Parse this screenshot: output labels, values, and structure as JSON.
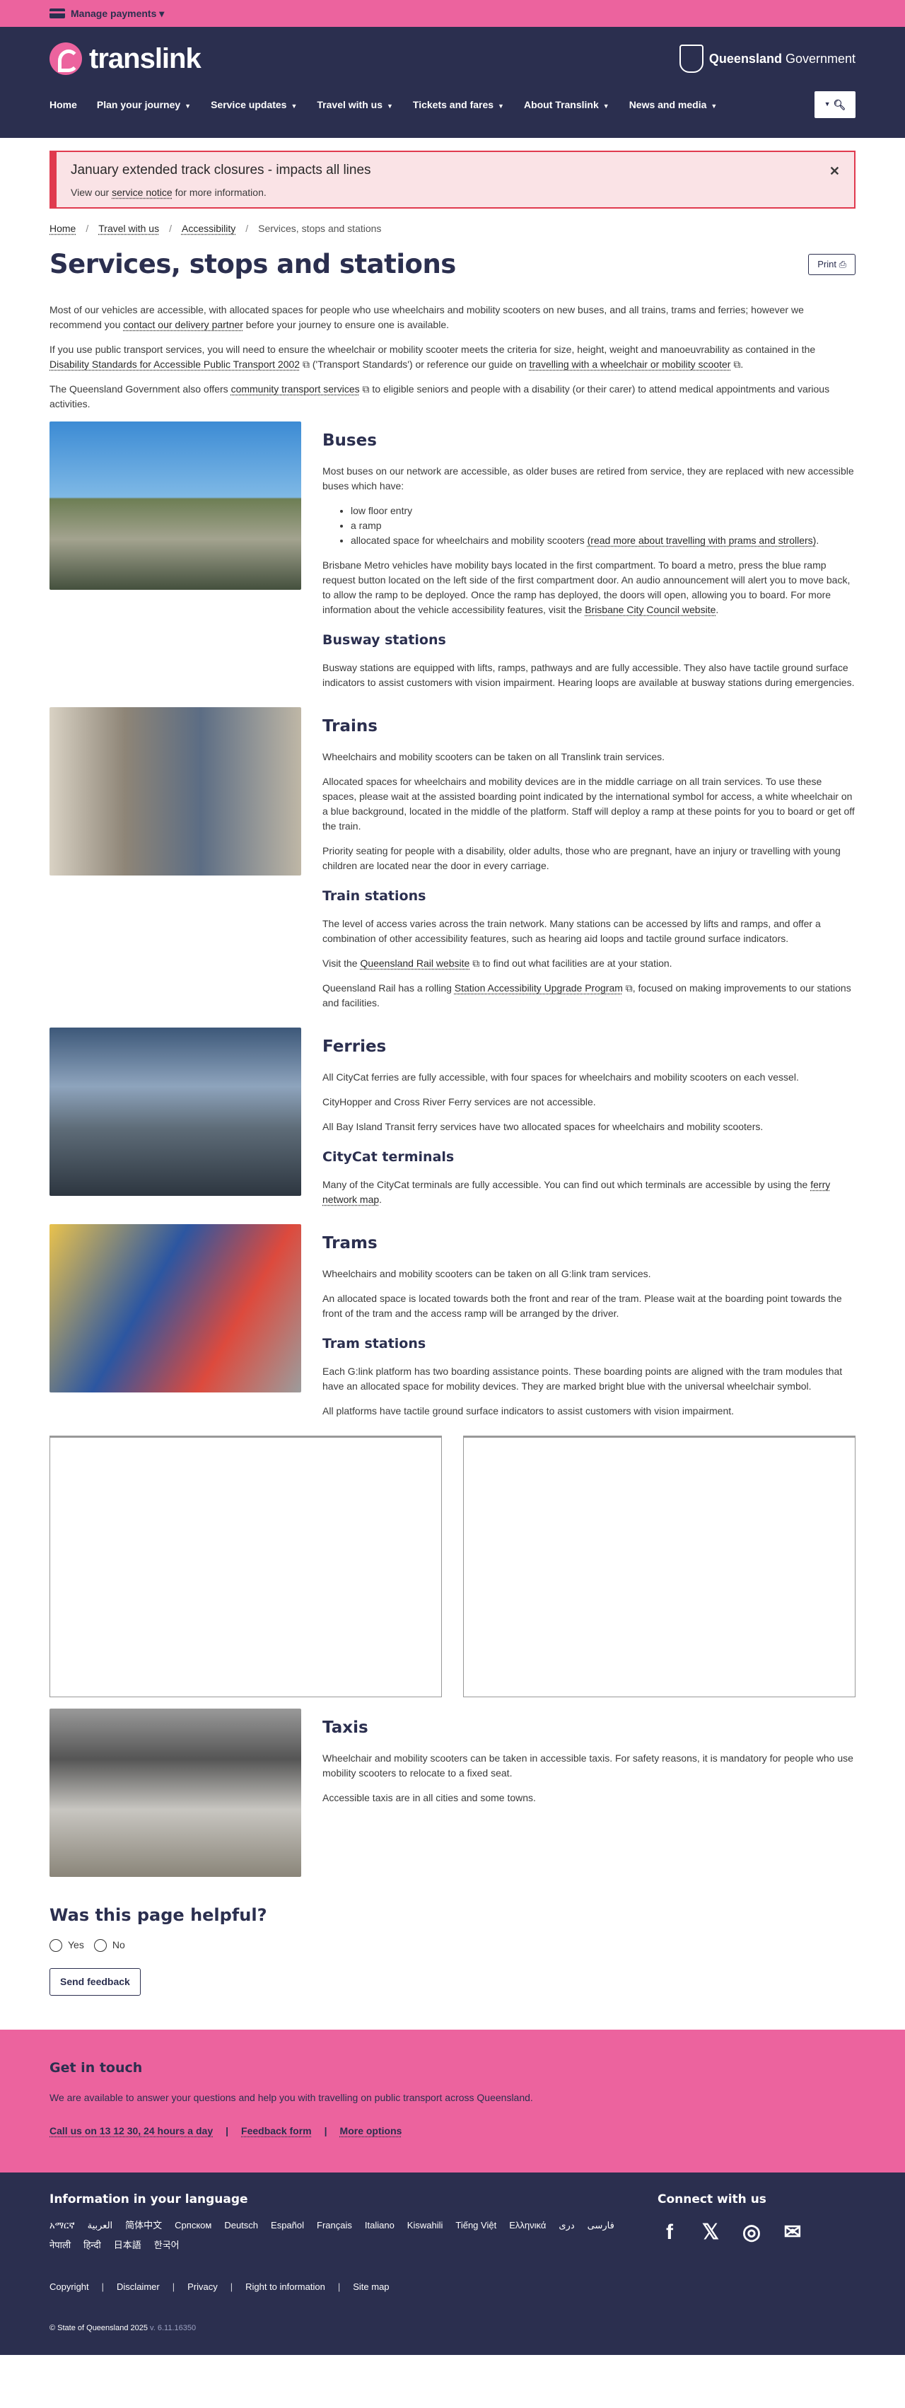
{
  "topbar": {
    "manage_payments": "Manage payments"
  },
  "header": {
    "brand": "translink",
    "qg_bold": "Queensland",
    "qg_rest": " Government",
    "nav": [
      "Home",
      "Plan your journey",
      "Service updates",
      "Travel with us",
      "Tickets and fares",
      "About Translink",
      "News and media"
    ]
  },
  "alert": {
    "title": "January extended track closures - impacts all lines",
    "text_before": "View our ",
    "link": "service notice",
    "text_after": " for more information."
  },
  "breadcrumb": [
    "Home",
    "Travel with us",
    "Accessibility",
    "Services, stops and stations"
  ],
  "page": {
    "title": "Services, stops and stations",
    "print": "Print"
  },
  "intro": {
    "p1_a": "Most of our vehicles are accessible, with allocated spaces for people who use wheelchairs and mobility scooters on new buses, and all trains, trams and ferries; however we recommend you ",
    "p1_link": "contact our delivery partner",
    "p1_b": " before your journey to ensure one is available.",
    "p2_a": "If you use public transport services, you will need to ensure the wheelchair or mobility scooter meets the criteria for size, height, weight and manoeuvrability as contained in the ",
    "p2_link1": "Disability Standards for Accessible Public Transport 2002",
    "p2_b": " ('Transport Standards') or reference our guide on ",
    "p2_link2": "travelling with a wheelchair or mobility scooter",
    "p2_c": ".",
    "p3_a": "The Queensland Government also offers ",
    "p3_link": "community transport services",
    "p3_b": " to eligible seniors and people with a disability (or their carer) to attend medical appointments and various activities."
  },
  "buses": {
    "title": "Buses",
    "p1": "Most buses on our network are accessible, as older buses are retired from service, they are replaced with new accessible buses which have:",
    "items": [
      "low floor entry",
      "a ramp",
      "allocated space for wheelchairs and mobility scooters"
    ],
    "item3_link": "(read more about travelling with prams and strollers)",
    "p2_a": "Brisbane Metro vehicles have mobility bays located in the first compartment. To board a metro, press the blue ramp request button located on the left side of the first compartment door. An audio announcement will alert you to move back, to allow the ramp to be deployed. Once the ramp has deployed, the doors will open, allowing you to board. For more information about the vehicle accessibility features, visit the ",
    "p2_link": "Brisbane City Council website",
    "p2_b": ".",
    "sub_title": "Busway stations",
    "sub_p": "Busway stations are equipped with lifts, ramps, pathways and are fully accessible. They also have tactile ground surface indicators to assist customers with vision impairment. Hearing loops are available at busway stations during emergencies."
  },
  "trains": {
    "title": "Trains",
    "p1": "Wheelchairs and mobility scooters can be taken on all Translink train services.",
    "p2": "Allocated spaces for wheelchairs and mobility devices are in the middle carriage on all train services. To use these spaces, please wait at the assisted boarding point indicated by the international symbol for access, a white wheelchair on a blue background, located in the middle of the platform. Staff will deploy a ramp at these points for you to board or get off the train.",
    "p3": "Priority seating for people with a disability, older adults, those who are pregnant, have an injury or travelling with young children are located near the door in every carriage.",
    "sub_title": "Train stations",
    "sub_p1": "The level of access varies across the train network. Many stations can be accessed by lifts and ramps, and offer a combination of other accessibility features, such as hearing aid loops and tactile ground surface indicators.",
    "sub_p2_a": "Visit the ",
    "sub_p2_link": "Queensland Rail website",
    "sub_p2_b": " to find out what facilities are at your station.",
    "sub_p3_a": "Queensland Rail has a rolling ",
    "sub_p3_link": "Station Accessibility Upgrade Program",
    "sub_p3_b": ", focused on making improvements to our stations and facilities."
  },
  "ferries": {
    "title": "Ferries",
    "p1": "All CityCat ferries are fully accessible, with four spaces for wheelchairs and mobility scooters on each vessel.",
    "p2": "CityHopper and Cross River Ferry services are not accessible.",
    "p3": "All Bay Island Transit ferry services have two allocated spaces for wheelchairs and mobility scooters.",
    "sub_title": "CityCat terminals",
    "sub_p_a": "Many of the CityCat terminals are fully accessible. You can find out which terminals are accessible by using the ",
    "sub_p_link": "ferry network map",
    "sub_p_b": "."
  },
  "trams": {
    "title": "Trams",
    "p1": "Wheelchairs and mobility scooters can be taken on all G:link tram services.",
    "p2": "An allocated space is located towards both the front and rear of the tram. Please wait at the boarding point towards the front of the tram and the access ramp will be arranged by the driver.",
    "sub_title": "Tram stations",
    "sub_p1": "Each G:link platform has two boarding assistance points. These boarding points are aligned with the tram modules that have an allocated space for mobility devices. They are marked bright blue with the universal wheelchair symbol.",
    "sub_p2": "All platforms have tactile ground surface indicators to assist customers with vision impairment."
  },
  "taxis": {
    "title": "Taxis",
    "p1": "Wheelchair and mobility scooters can be taken in accessible taxis. For safety reasons, it is mandatory for people who use mobility scooters to relocate to a fixed seat.",
    "p2": "Accessible taxis are in all cities and some towns."
  },
  "feedback": {
    "title": "Was this page helpful?",
    "yes": "Yes",
    "no": "No",
    "send": "Send feedback"
  },
  "contact": {
    "title": "Get in touch",
    "text": "We are available to answer your questions and help you with travelling on public transport across Queensland.",
    "links": [
      "Call us on 13 12 30, 24 hours a day",
      "Feedback form",
      "More options"
    ]
  },
  "footer": {
    "lang_title": "Information in your language",
    "languages": [
      "አማርኛ",
      "العربية",
      "简体中文",
      "Српском",
      "Deutsch",
      "Español",
      "Français",
      "Italiano",
      "Kiswahili",
      "Tiếng Việt",
      "Ελληνικά",
      "دری",
      "فارسی",
      "नेपाली",
      "हिन्दी",
      "日本語",
      "한국어"
    ],
    "connect_title": "Connect with us",
    "social": [
      "facebook-icon",
      "x-icon",
      "instagram-icon",
      "email-icon"
    ],
    "legal": [
      "Copyright",
      "Disclaimer",
      "Privacy",
      "Right to information",
      "Site map"
    ],
    "copyright": "© State of Queensland 2025",
    "version": "v. 6.11.16350"
  },
  "colors": {
    "pink": "#ec639e",
    "navy": "#2b2f4f",
    "alert_red": "#e03a4e"
  }
}
